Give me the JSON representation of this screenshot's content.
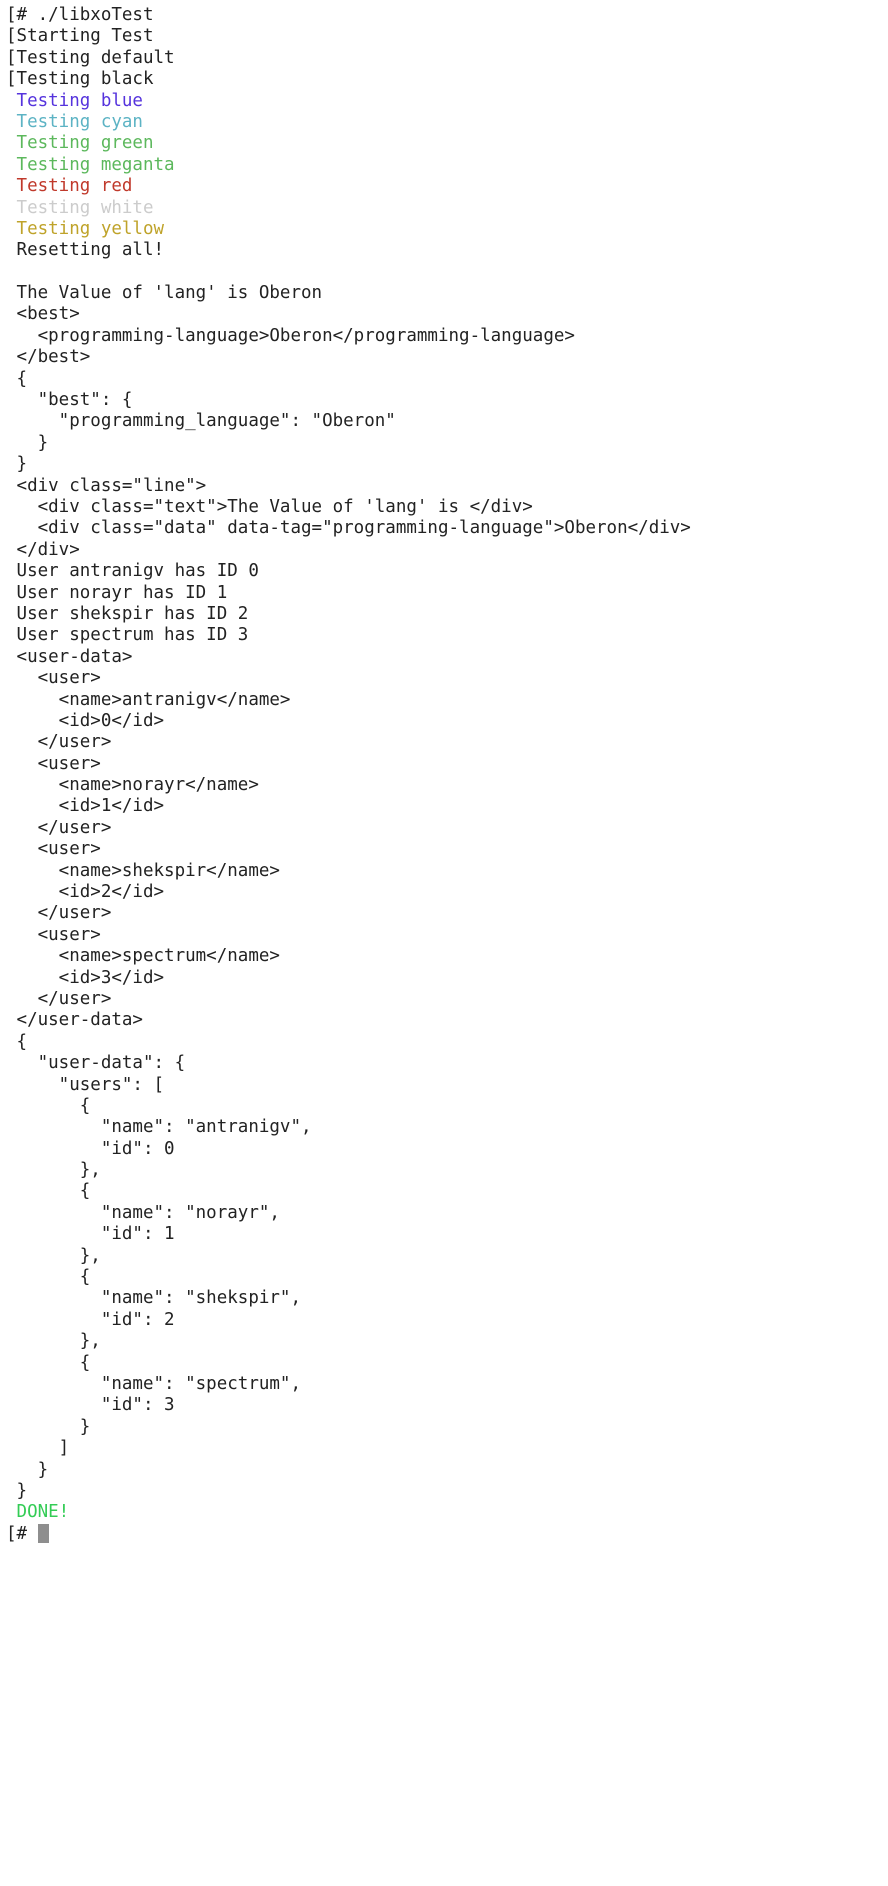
{
  "terminal": {
    "title": "libxoTest terminal session",
    "background_color": "#ffffff",
    "default_text_color": "#222222",
    "prompt": "[# ",
    "command": "./libxoTest",
    "colors": {
      "default": "#222222",
      "black": "#222222",
      "blue": "#5533dd",
      "cyan": "#5cb3c4",
      "green": "#5cb85c",
      "megenta": "#5cb85c",
      "red": "#c0392b",
      "white": "#cccccc",
      "yellow": "#bfa32a",
      "done": "#33cc55",
      "escape_glyph": "#6d6d6d",
      "cursor": "#8e8e8e"
    },
    "lines": [
      {
        "text": "[# ./libxoTest",
        "color": "default",
        "esc": true
      },
      {
        "text": "[Starting Test",
        "color": "default",
        "esc": true
      },
      {
        "text": "[Testing default",
        "color": "default",
        "esc": true
      },
      {
        "text": "[Testing black",
        "color": "default",
        "esc": true
      },
      {
        "text": " Testing blue",
        "color": "blue",
        "esc": true
      },
      {
        "text": " Testing cyan",
        "color": "cyan",
        "esc": true
      },
      {
        "text": " Testing green",
        "color": "green",
        "esc": true
      },
      {
        "text": " Testing meganta",
        "color": "megenta",
        "esc": true
      },
      {
        "text": " Testing red",
        "color": "red",
        "esc": true
      },
      {
        "text": " Testing white",
        "color": "white",
        "esc": true
      },
      {
        "text": " Testing yellow",
        "color": "yellow",
        "esc": true
      },
      {
        "text": " Resetting all!",
        "color": "default",
        "esc": true
      },
      {
        "text": "",
        "color": "default",
        "esc": false
      },
      {
        "text": " The Value of 'lang' is Oberon",
        "color": "default",
        "esc": false
      },
      {
        "text": " <best>",
        "color": "default",
        "esc": false
      },
      {
        "text": "   <programming-language>Oberon</programming-language>",
        "color": "default",
        "esc": false
      },
      {
        "text": " </best>",
        "color": "default",
        "esc": false
      },
      {
        "text": " {",
        "color": "default",
        "esc": false
      },
      {
        "text": "   \"best\": {",
        "color": "default",
        "esc": false
      },
      {
        "text": "     \"programming_language\": \"Oberon\"",
        "color": "default",
        "esc": false
      },
      {
        "text": "   }",
        "color": "default",
        "esc": false
      },
      {
        "text": " }",
        "color": "default",
        "esc": false
      },
      {
        "text": " <div class=\"line\">",
        "color": "default",
        "esc": false
      },
      {
        "text": "   <div class=\"text\">The Value of 'lang' is </div>",
        "color": "default",
        "esc": false
      },
      {
        "text": "   <div class=\"data\" data-tag=\"programming-language\">Oberon</div>",
        "color": "default",
        "esc": false
      },
      {
        "text": " </div>",
        "color": "default",
        "esc": false
      },
      {
        "text": " User antranigv has ID 0",
        "color": "default",
        "esc": false
      },
      {
        "text": " User norayr has ID 1",
        "color": "default",
        "esc": false
      },
      {
        "text": " User shekspir has ID 2",
        "color": "default",
        "esc": false
      },
      {
        "text": " User spectrum has ID 3",
        "color": "default",
        "esc": false
      },
      {
        "text": " <user-data>",
        "color": "default",
        "esc": false
      },
      {
        "text": "   <user>",
        "color": "default",
        "esc": false
      },
      {
        "text": "     <name>antranigv</name>",
        "color": "default",
        "esc": false
      },
      {
        "text": "     <id>0</id>",
        "color": "default",
        "esc": false
      },
      {
        "text": "   </user>",
        "color": "default",
        "esc": false
      },
      {
        "text": "   <user>",
        "color": "default",
        "esc": false
      },
      {
        "text": "     <name>norayr</name>",
        "color": "default",
        "esc": false
      },
      {
        "text": "     <id>1</id>",
        "color": "default",
        "esc": false
      },
      {
        "text": "   </user>",
        "color": "default",
        "esc": false
      },
      {
        "text": "   <user>",
        "color": "default",
        "esc": false
      },
      {
        "text": "     <name>shekspir</name>",
        "color": "default",
        "esc": false
      },
      {
        "text": "     <id>2</id>",
        "color": "default",
        "esc": false
      },
      {
        "text": "   </user>",
        "color": "default",
        "esc": false
      },
      {
        "text": "   <user>",
        "color": "default",
        "esc": false
      },
      {
        "text": "     <name>spectrum</name>",
        "color": "default",
        "esc": false
      },
      {
        "text": "     <id>3</id>",
        "color": "default",
        "esc": false
      },
      {
        "text": "   </user>",
        "color": "default",
        "esc": false
      },
      {
        "text": " </user-data>",
        "color": "default",
        "esc": false
      },
      {
        "text": " {",
        "color": "default",
        "esc": false
      },
      {
        "text": "   \"user-data\": {",
        "color": "default",
        "esc": false
      },
      {
        "text": "     \"users\": [",
        "color": "default",
        "esc": false
      },
      {
        "text": "       {",
        "color": "default",
        "esc": false
      },
      {
        "text": "         \"name\": \"antranigv\",",
        "color": "default",
        "esc": false
      },
      {
        "text": "         \"id\": 0",
        "color": "default",
        "esc": false
      },
      {
        "text": "       },",
        "color": "default",
        "esc": false
      },
      {
        "text": "       {",
        "color": "default",
        "esc": false
      },
      {
        "text": "         \"name\": \"norayr\",",
        "color": "default",
        "esc": false
      },
      {
        "text": "         \"id\": 1",
        "color": "default",
        "esc": false
      },
      {
        "text": "       },",
        "color": "default",
        "esc": false
      },
      {
        "text": "       {",
        "color": "default",
        "esc": false
      },
      {
        "text": "         \"name\": \"shekspir\",",
        "color": "default",
        "esc": false
      },
      {
        "text": "         \"id\": 2",
        "color": "default",
        "esc": false
      },
      {
        "text": "       },",
        "color": "default",
        "esc": false
      },
      {
        "text": "       {",
        "color": "default",
        "esc": false
      },
      {
        "text": "         \"name\": \"spectrum\",",
        "color": "default",
        "esc": false
      },
      {
        "text": "         \"id\": 3",
        "color": "default",
        "esc": false
      },
      {
        "text": "       }",
        "color": "default",
        "esc": false
      },
      {
        "text": "     ]",
        "color": "default",
        "esc": false
      },
      {
        "text": "   }",
        "color": "default",
        "esc": false
      },
      {
        "text": " }",
        "color": "default",
        "esc": false
      },
      {
        "text": " DONE!",
        "color": "done",
        "esc": false
      },
      {
        "text": "[# ",
        "color": "default",
        "esc": true,
        "cursor": true
      }
    ]
  }
}
